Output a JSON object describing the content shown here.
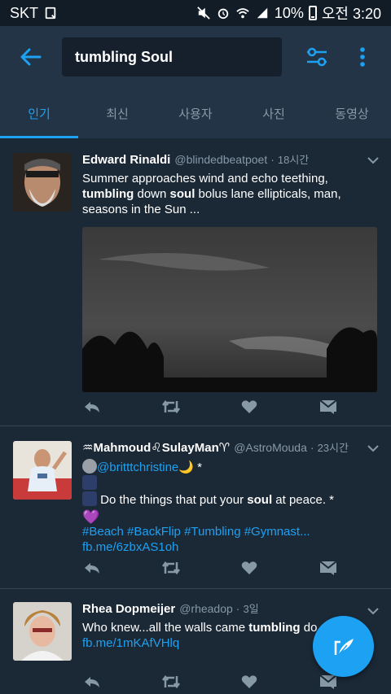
{
  "status_bar": {
    "carrier": "SKT",
    "battery": "10%",
    "time": "오전 3:20"
  },
  "search": {
    "query": "tumbling Soul"
  },
  "tabs": [
    {
      "label": "인기",
      "active": true
    },
    {
      "label": "최신",
      "active": false
    },
    {
      "label": "사용자",
      "active": false
    },
    {
      "label": "사진",
      "active": false
    },
    {
      "label": "동영상",
      "active": false
    }
  ],
  "tweets": [
    {
      "name": "Edward Rinaldi",
      "handle": "@blindedbeatpoet",
      "time": "18시간",
      "text_parts": [
        [
          "Summer approaches  wind and echo  teething, ",
          false
        ],
        [
          "tumbling",
          true
        ],
        [
          " down  ",
          false
        ],
        [
          "soul",
          true
        ],
        [
          " bolus lane  ellipticals, man, seasons in the Sun ...",
          false
        ]
      ]
    },
    {
      "name": "♒Mahmoud♌SulayMan♈",
      "handle": "@AstroMouda",
      "time": "23시간",
      "mention": "@britttchristine",
      "line1_suffix": " *",
      "line2_pre": " Do the things that put your ",
      "line2_bold": "soul",
      "line2_post": " at peace. *",
      "hashtags": "#Beach #BackFlip #Tumbling #Gymnast...",
      "link": "fb.me/6zbxAS1oh"
    },
    {
      "name": "Rhea Dopmeijer",
      "handle": "@rheadop",
      "time": "3일",
      "text_pre": "Who knew...all the walls came ",
      "text_bold": "tumbling",
      "text_post": " do",
      "link": "fb.me/1mKAfVHlq"
    }
  ],
  "colors": {
    "accent": "#1da1f2",
    "background": "#1b2836",
    "header": "#243447"
  }
}
